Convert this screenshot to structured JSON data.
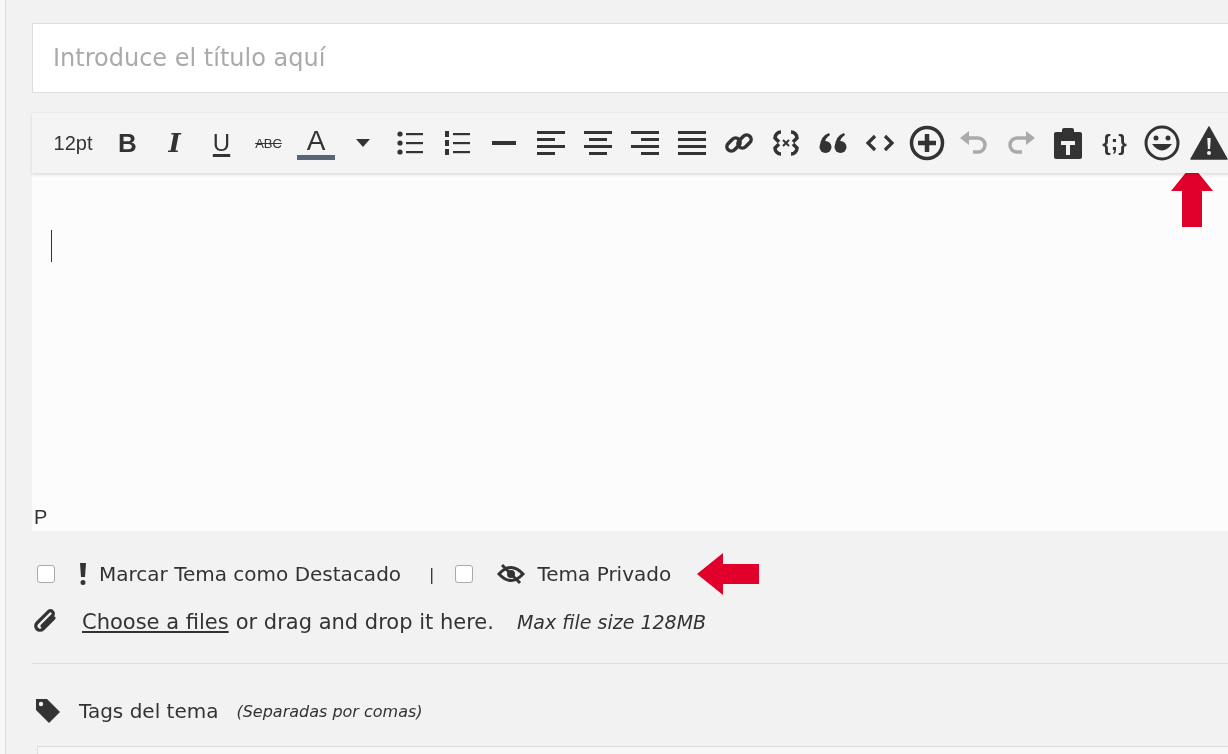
{
  "title_field": {
    "placeholder": "Introduce el título aquí"
  },
  "toolbar": [
    {
      "kind": "size",
      "label": "12pt",
      "disabled": false
    },
    {
      "kind": "bold",
      "label": "B",
      "disabled": false
    },
    {
      "kind": "italic",
      "label": "I",
      "disabled": false
    },
    {
      "kind": "underline",
      "label": "U",
      "disabled": false
    },
    {
      "kind": "strike",
      "label": "ABC",
      "disabled": false
    },
    {
      "kind": "color",
      "label": "A",
      "disabled": false
    },
    {
      "kind": "icon",
      "disabled": false
    },
    {
      "kind": "icon",
      "disabled": false
    },
    {
      "kind": "icon",
      "disabled": false
    },
    {
      "kind": "icon",
      "disabled": false
    },
    {
      "kind": "icon",
      "disabled": false
    },
    {
      "kind": "icon",
      "disabled": false
    },
    {
      "kind": "icon",
      "disabled": false
    },
    {
      "kind": "icon",
      "disabled": false
    },
    {
      "kind": "icon",
      "disabled": false
    },
    {
      "kind": "icon",
      "disabled": false
    },
    {
      "kind": "icon",
      "disabled": false
    },
    {
      "kind": "icon",
      "disabled": false
    },
    {
      "kind": "icon",
      "disabled": false
    },
    {
      "kind": "icon",
      "disabled": true
    },
    {
      "kind": "icon",
      "disabled": true
    },
    {
      "kind": "icon",
      "disabled": false
    },
    {
      "kind": "code",
      "label": "{;}",
      "disabled": false
    },
    {
      "kind": "icon",
      "disabled": false
    },
    {
      "kind": "icon",
      "disabled": false
    }
  ],
  "editor": {
    "status_path": "P"
  },
  "options": [
    {
      "label": "Marcar Tema como Destacado",
      "checked": false
    },
    {
      "label": "Tema Privado",
      "checked": false
    }
  ],
  "options_separator": "|",
  "upload": {
    "link": "Choose a files",
    "text": "or drag and drop it here.",
    "limit": "Max file size 128MB"
  },
  "tags": {
    "label": "Tags del tema",
    "hint": "(Separadas por comas)"
  }
}
